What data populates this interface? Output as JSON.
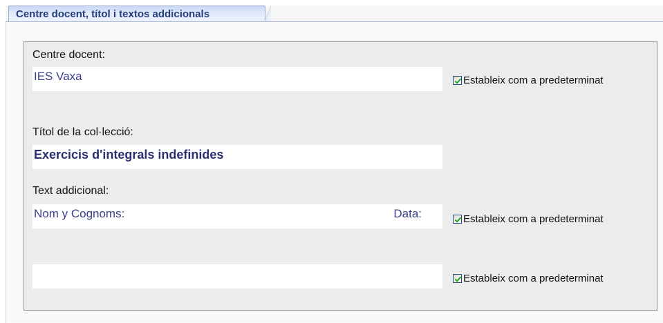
{
  "tab": {
    "label": "Centre docent, títol i textos addicionals"
  },
  "centre": {
    "label": "Centre docent:",
    "value": "IES Vaxa",
    "checkbox_label": "Estableix com a predeterminat",
    "checked": true
  },
  "titol": {
    "label": "Títol de la col·lecció:",
    "value": "Exercicis d'integrals indefinides"
  },
  "text_addicional": {
    "label": "Text addicional:",
    "value_left": "Nom y Cognoms:",
    "value_right": "Data:",
    "checkbox_label": "Estableix com a predeterminat",
    "checked": true
  },
  "text_addicional_2": {
    "value": "",
    "checkbox_label": "Estableix com a predeterminat",
    "checked": true
  },
  "colors": {
    "tab_text": "#233e7a",
    "field_text": "#3b3f8a",
    "checkmark": "#21a121"
  }
}
